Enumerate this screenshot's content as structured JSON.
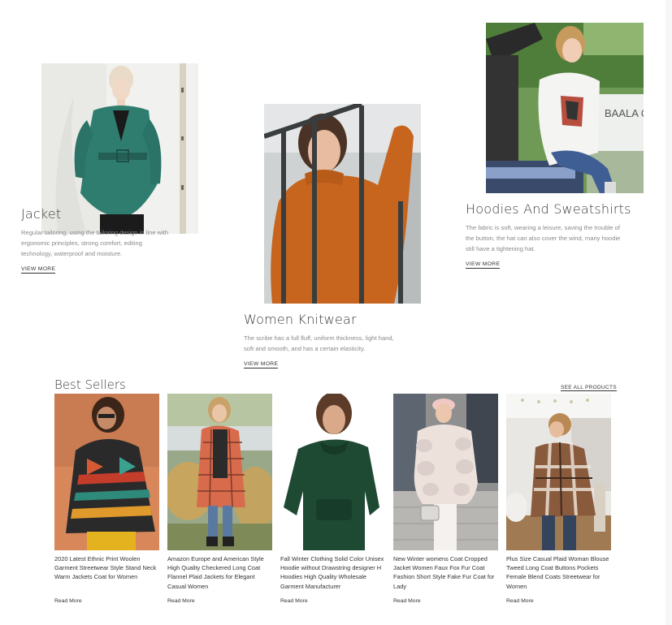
{
  "categories": [
    {
      "title": "Jacket",
      "description": "Regular tailoring, using the tailoring design in line with ergonomic principles, strong comfort, editing technology, waterproof and moisture.",
      "link": "VIEW MORE"
    },
    {
      "title": "Women Knitwear",
      "description": "The scribe has a full fluff, uniform thickness, light hand, soft and smooth, and has a certain elasticity.",
      "link": "VIEW MORE"
    },
    {
      "title": "Hoodies And Sweatshirts",
      "description": "The fabric is soft, wearing a leisure, saving the trouble of the button, the hat can also cover the wind, many hoodie still have a tightening hat.",
      "link": "VIEW MORE",
      "photo_sign": "BAALA CAFE&F"
    }
  ],
  "best_sellers": {
    "title": "Best Sellers",
    "see_all": "SEE ALL PRODUCTS",
    "products": [
      {
        "name": "2020 Latest Ethnic Print Woolen Garment Streetwear Style Stand Neck Warm Jackets Coat for Women",
        "link": "Read More"
      },
      {
        "name": "Amazon Europe and American Style High Quality Checkered Long Coat Flannel Plaid Jackets for Elegant Casual Women",
        "link": "Read More"
      },
      {
        "name": "Fall Winter Clothing Solid Color Unisex Hoodie without Drawstring designer H Hoodies High Quality Wholesale Garment Manufacturer",
        "link": "Read More"
      },
      {
        "name": "New Winter womens Coat Cropped Jacket Women Faux Fox Fur Coat Fashion Short Style Fake Fur Coat for Lady",
        "link": "Read More"
      },
      {
        "name": "Plus Size Casual Plaid Woman Blouse Tweed Long Coat Buttons Pockets Female Blend Coats Streetwear for Women",
        "link": "Read More"
      }
    ]
  }
}
